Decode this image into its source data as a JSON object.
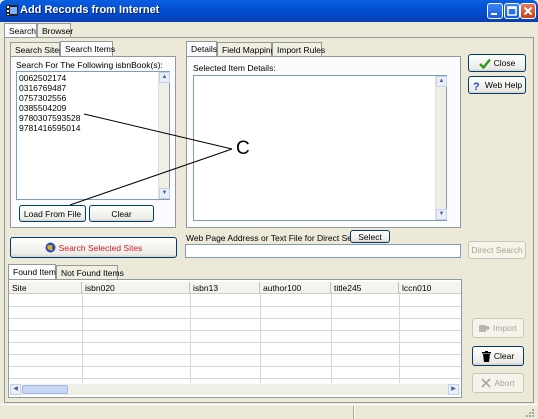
{
  "window": {
    "title": "Add Records from Internet"
  },
  "top_tabs": [
    {
      "label": "Search"
    },
    {
      "label": "Browser"
    }
  ],
  "left_tabs": [
    {
      "label": "Search Sites"
    },
    {
      "label": "Search Items"
    }
  ],
  "search_items": {
    "label": "Search For The Following isbnBook(s):",
    "lines": [
      "0062502174",
      "0316769487",
      "0757302556",
      "0385504209",
      "9780307593528",
      "9781416595014"
    ]
  },
  "buttons": {
    "load_from_file": "Load From File",
    "clear_left": "Clear",
    "search_selected_sites": "Search Selected Sites",
    "close": "Close",
    "web_help": "Web Help",
    "select": "Select",
    "direct_search": "Direct Search",
    "import": "Import",
    "clear_right": "Clear",
    "abort": "Abort"
  },
  "detail_tabs": [
    {
      "label": "Details"
    },
    {
      "label": "Field Mapping"
    },
    {
      "label": "Import Rules"
    }
  ],
  "details": {
    "label": "Selected Item Details:"
  },
  "web_page": {
    "label": "Web Page Address or Text File for Direct Search:",
    "value": ""
  },
  "results_tabs": [
    {
      "label": "Found Items"
    },
    {
      "label": "Not Found Items"
    }
  ],
  "results_columns": [
    "Site",
    "isbn020",
    "isbn13",
    "author100",
    "title245",
    "lccn010"
  ],
  "annotation": {
    "letter": "C"
  },
  "colors": {
    "titlebar": "#0453d6",
    "close_check": "#2a9a1a",
    "search_globe": "#2a4fb8",
    "search_text": "#d02020"
  }
}
